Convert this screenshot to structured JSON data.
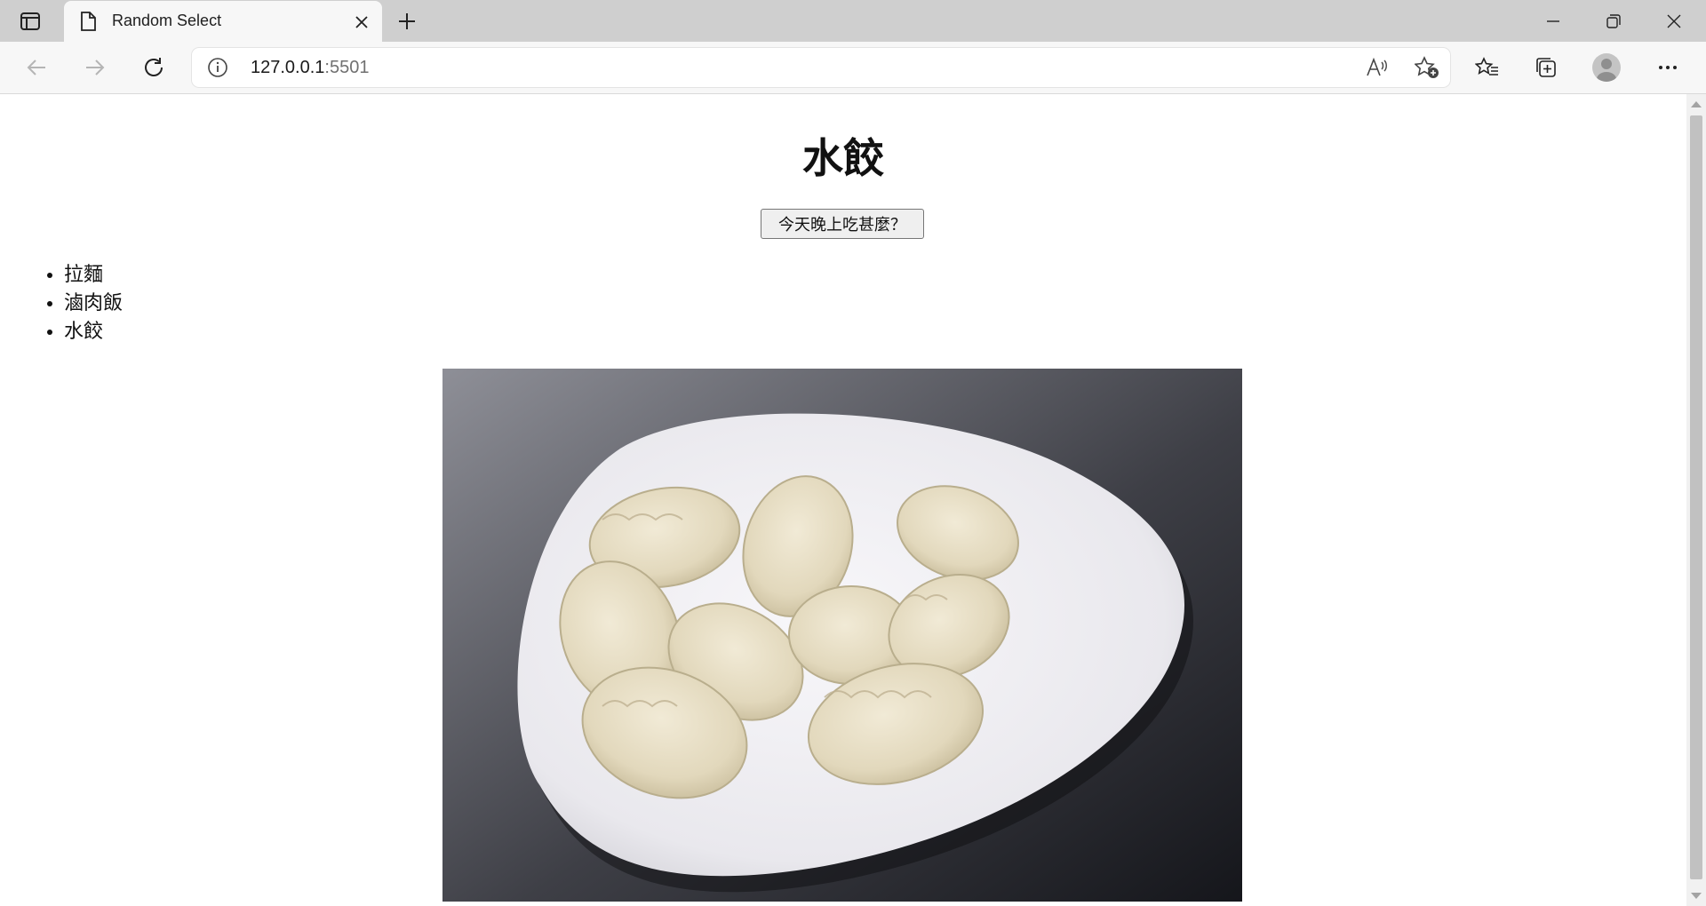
{
  "browser": {
    "tab_title": "Random Select",
    "url_host": "127.0.0.1",
    "url_port": ":5501"
  },
  "page": {
    "heading": "水餃",
    "button_label": "今天晚上吃甚麼？",
    "menu_items": [
      "拉麵",
      "滷肉飯",
      "水餃"
    ]
  },
  "colors": {
    "tabbar": "#cfcfcf",
    "toolbar": "#f7f7f7",
    "plate": "#f2f1f4",
    "dumpling": "#e6dcc2"
  }
}
